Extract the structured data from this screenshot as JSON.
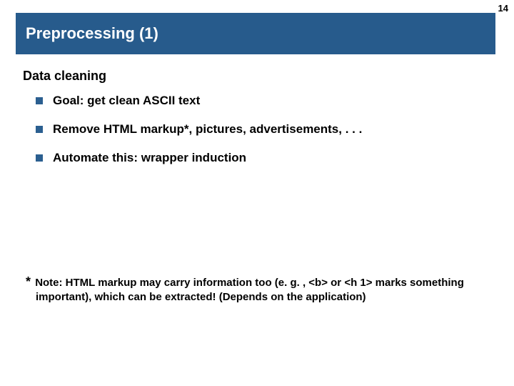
{
  "page_number": "14",
  "title": "Preprocessing (1)",
  "heading": "Data cleaning",
  "bullets": [
    "Goal: get clean ASCII text",
    "Remove HTML markup*, pictures, advertisements, . . .",
    "Automate this: wrapper induction"
  ],
  "footnote_star": "*",
  "footnote": "Note: HTML markup may carry information too (e. g. , <b> or <h 1> marks something important), which can be extracted! (Depends on the application)"
}
